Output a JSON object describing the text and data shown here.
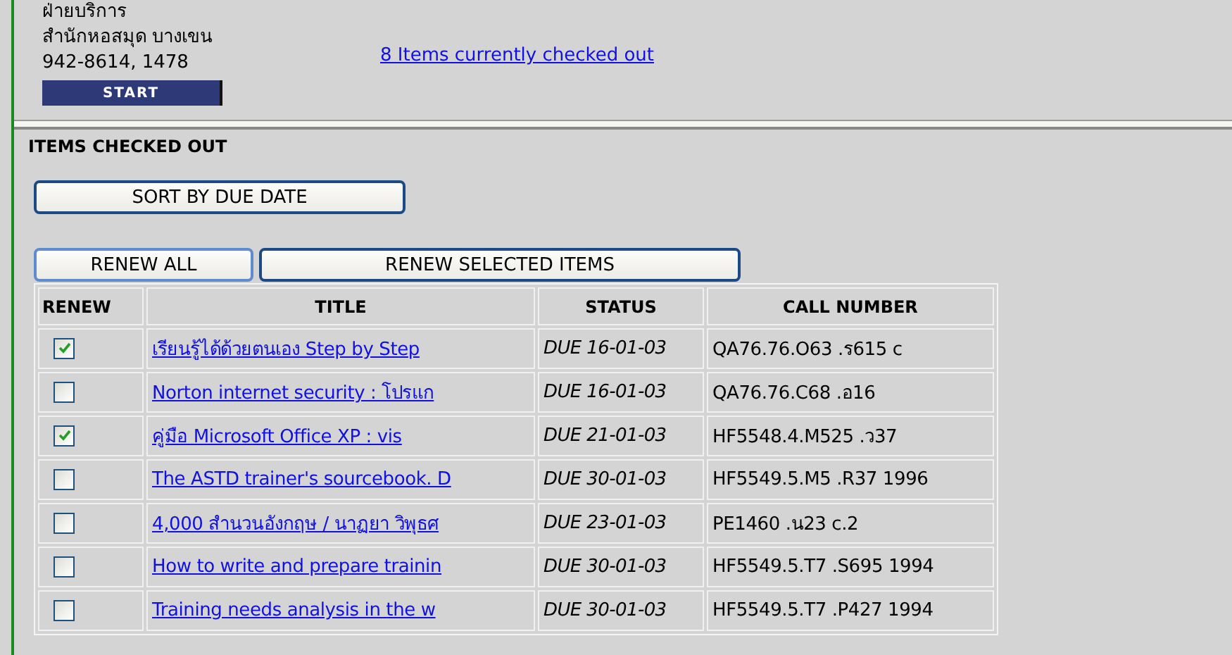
{
  "header": {
    "lines": [
      "ฝ่ายบริการ",
      "สำนักหอสมุด บางเขน",
      "942-8614, 1478"
    ],
    "start_button": "START",
    "checked_out_link": "8 Items currently checked out"
  },
  "section_title": "ITEMS CHECKED OUT",
  "sort_button": "SORT BY DUE DATE",
  "renew_buttons": [
    "RENEW ALL",
    "RENEW SELECTED ITEMS"
  ],
  "table": {
    "columns": [
      "RENEW",
      "TITLE",
      "STATUS",
      "CALL NUMBER"
    ],
    "rows": [
      {
        "checked": true,
        "title": "เรียนรู้ได้ด้วยตนเอง Step by Step ",
        "status": "DUE 16-01-03",
        "call_number": "QA76.76.O63 .ร615 c"
      },
      {
        "checked": false,
        "title": "Norton internet security : โปรแก ",
        "status": "DUE 16-01-03",
        "call_number": "QA76.76.C68 .อ16"
      },
      {
        "checked": true,
        "title": "คู่มือ Microsoft Office XP : vis ",
        "status": "DUE 21-01-03",
        "call_number": "HF5548.4.M525 .ว37"
      },
      {
        "checked": false,
        "title": "The ASTD trainer's sourcebook. D",
        "status": "DUE 30-01-03",
        "call_number": "HF5549.5.M5 .R37 1996"
      },
      {
        "checked": false,
        "title": "4,000 สำนวนอังกฤษ / นาฏยา วิพุธศ",
        "status": "DUE 23-01-03",
        "call_number": "PE1460 .น23 c.2"
      },
      {
        "checked": false,
        "title": "How to write and prepare trainin",
        "status": "DUE 30-01-03",
        "call_number": "HF5549.5.T7 .S695 1994"
      },
      {
        "checked": false,
        "title": "Training needs analysis in the w",
        "status": "DUE 30-01-03",
        "call_number": "HF5549.5.T7 .P427 1994"
      }
    ]
  }
}
